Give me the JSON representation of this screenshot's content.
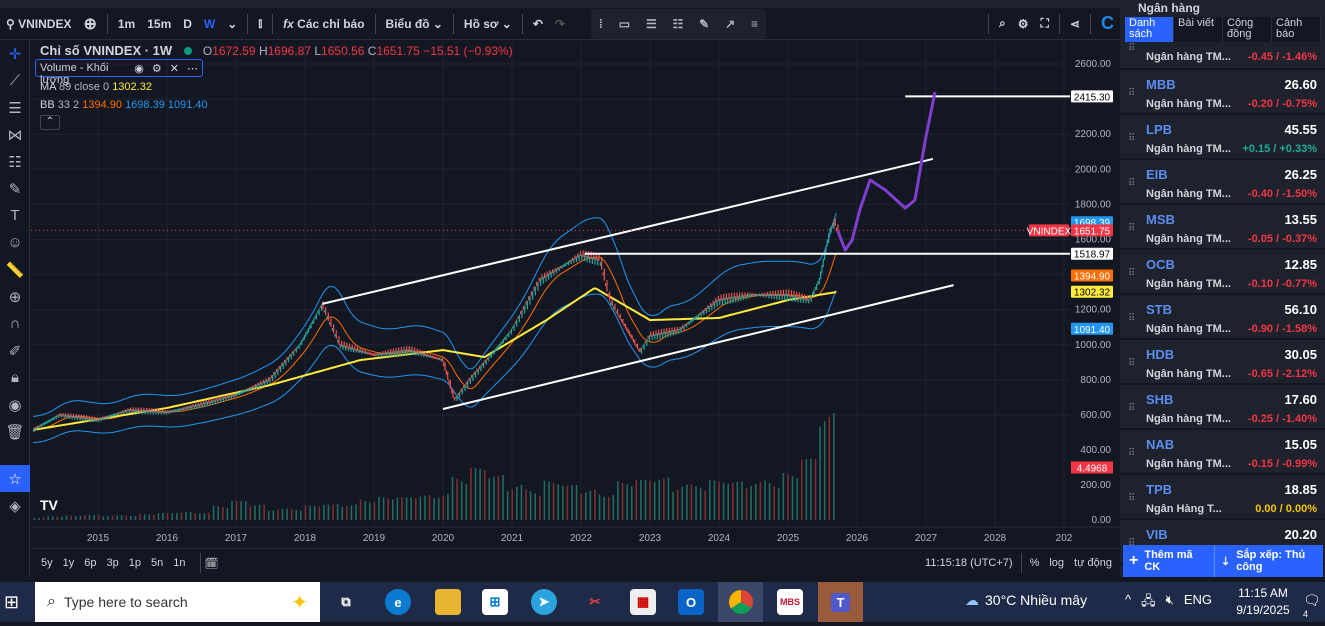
{
  "toolbar": {
    "symbol": "VNINDEX",
    "intervals": [
      "1m",
      "15m",
      "D",
      "W"
    ],
    "indicators": "Các chỉ báo",
    "chart": "Biểu đồ",
    "profile": "Hồ sơ"
  },
  "legend": {
    "title": "Chỉ số VNINDEX · 1W",
    "o_label": "O",
    "o": "1672.59",
    "h_label": "H",
    "h": "1696.87",
    "l_label": "L",
    "l": "1650.56",
    "c_label": "C",
    "c": "1651.75",
    "change": "−15.51 (−0.93%)",
    "volume": "Volume - Khối lượng",
    "ma_label": "MA",
    "ma_params": "89 close 0",
    "ma_value": "1302.32",
    "bb_label": "BB",
    "bb_params": "33 2",
    "bb_mid": "1394.90",
    "bb_upper": "1698.39",
    "bb_lower": "1091.40"
  },
  "price_axis": {
    "ticks": [
      "2600.00",
      "2400.00",
      "2200.00",
      "2000.00",
      "1800.00",
      "1600.00",
      "1400.00",
      "1200.00",
      "1000.00",
      "800.00",
      "600.00"
    ],
    "volume_ticks": [
      "400.00",
      "200.00",
      "0.00"
    ],
    "labels": {
      "line2415": "2415.30",
      "bb_upper": "1698.39",
      "last": "1651.75",
      "symbol_tag": "VNINDEX",
      "line1518": "1518.97",
      "bb_mid": "1394.90",
      "ma": "1302.32",
      "bb_lower": "1091.40",
      "volume": "4.4968"
    }
  },
  "time_axis": {
    "ticks": [
      "2015",
      "2016",
      "2017",
      "2018",
      "2019",
      "2020",
      "2021",
      "2022",
      "2023",
      "2024",
      "2025",
      "2026",
      "2027",
      "2028",
      "202"
    ]
  },
  "bottombar": {
    "ranges": [
      "5y",
      "1y",
      "6p",
      "3p",
      "1p",
      "5n",
      "1n"
    ],
    "clock": "11:15:18 (UTC+7)",
    "percent": "%",
    "log": "log",
    "auto": "tự động"
  },
  "colors": {
    "bg": "#131722",
    "up": "#26a69a",
    "down": "#ef5350",
    "ma": "#ffeb3b",
    "bb_mid": "#ff6d00",
    "bb_band": "#2196f3",
    "projection": "#7e3fd1",
    "channel": "#ffffff"
  },
  "chart_data": {
    "type": "line",
    "price": [
      [
        2014.06,
        515
      ],
      [
        2014.45,
        600
      ],
      [
        2015,
        572
      ],
      [
        2015.46,
        628
      ],
      [
        2016,
        615
      ],
      [
        2016.48,
        657
      ],
      [
        2017,
        714
      ],
      [
        2017.49,
        800
      ],
      [
        2017.93,
        999
      ],
      [
        2018.25,
        1227
      ],
      [
        2018.51,
        999
      ],
      [
        2019.01,
        942
      ],
      [
        2019.52,
        970
      ],
      [
        2020,
        913
      ],
      [
        2020.17,
        685
      ],
      [
        2020.39,
        800
      ],
      [
        2020.83,
        1000
      ],
      [
        2021,
        1084
      ],
      [
        2021.41,
        1369
      ],
      [
        2022,
        1511
      ],
      [
        2022.28,
        1483
      ],
      [
        2022.42,
        1255
      ],
      [
        2022.86,
        960
      ],
      [
        2023,
        1050
      ],
      [
        2023.43,
        1084
      ],
      [
        2024,
        1255
      ],
      [
        2024.46,
        1284
      ],
      [
        2025,
        1284
      ],
      [
        2025.32,
        1255
      ],
      [
        2025.46,
        1369
      ],
      [
        2025.61,
        1654
      ],
      [
        2025.68,
        1700
      ],
      [
        2025.72,
        1651
      ]
    ],
    "ma89": [
      [
        2014.06,
        515
      ],
      [
        2016,
        640
      ],
      [
        2017.5,
        771
      ],
      [
        2018.8,
        913
      ],
      [
        2020,
        970
      ],
      [
        2020.6,
        930
      ],
      [
        2021.5,
        1141
      ],
      [
        2022.2,
        1324
      ],
      [
        2023,
        1141
      ],
      [
        2024,
        1153
      ],
      [
        2025,
        1255
      ],
      [
        2025.72,
        1302
      ]
    ],
    "projection": [
      [
        2025.72,
        1651
      ],
      [
        2025.83,
        1540
      ],
      [
        2025.93,
        1597
      ],
      [
        2026.04,
        1768
      ],
      [
        2026.19,
        1939
      ],
      [
        2026.41,
        1882
      ],
      [
        2026.7,
        1779
      ],
      [
        2026.84,
        1825
      ],
      [
        2026.99,
        2167
      ],
      [
        2027.13,
        2440
      ]
    ],
    "channel_upper": [
      [
        2018.25,
        1233
      ],
      [
        2027.1,
        2059
      ]
    ],
    "channel_lower": [
      [
        2020,
        634
      ],
      [
        2027.4,
        1340
      ]
    ],
    "hlines": [
      {
        "value": 1518.97,
        "from": 2022.05
      },
      {
        "value": 2415.3,
        "from": 2026.7
      }
    ],
    "volume": [
      20,
      25,
      25,
      30,
      30,
      35,
      35,
      40,
      50,
      60,
      90,
      110,
      90,
      80,
      80,
      85,
      90,
      100,
      160,
      140,
      130,
      150,
      200,
      280,
      300,
      260,
      240,
      220,
      230,
      200,
      190,
      210,
      240,
      230,
      250,
      260,
      240,
      230,
      220,
      250,
      300,
      280,
      350,
      650
    ],
    "volume_range": [
      2014.0,
      2025.72
    ],
    "ylim": [
      0,
      2600
    ],
    "xlim": [
      2014,
      2029
    ]
  },
  "panel": {
    "header": "Ngân hàng",
    "tabs": [
      "Danh sách",
      "Bài viết",
      "Cộng đồng",
      "Cảnh báo"
    ],
    "first_row": {
      "name": "Ngân hàng TM...",
      "change": "-0.45 / -1.46%"
    },
    "rows": [
      {
        "sym": "MBB",
        "price": "26.60",
        "name": "Ngân hàng TM...",
        "change": "-0.20 / -0.75%",
        "dir": "down"
      },
      {
        "sym": "LPB",
        "price": "45.55",
        "name": "Ngân hàng TM...",
        "change": "+0.15 / +0.33%",
        "dir": "up"
      },
      {
        "sym": "EIB",
        "price": "26.25",
        "name": "Ngân hàng TM...",
        "change": "-0.40 / -1.50%",
        "dir": "down"
      },
      {
        "sym": "MSB",
        "price": "13.55",
        "name": "Ngân hàng TM...",
        "change": "-0.05 / -0.37%",
        "dir": "down"
      },
      {
        "sym": "OCB",
        "price": "12.85",
        "name": "Ngân hàng TM...",
        "change": "-0.10 / -0.77%",
        "dir": "down"
      },
      {
        "sym": "STB",
        "price": "56.10",
        "name": "Ngân hàng TM...",
        "change": "-0.90 / -1.58%",
        "dir": "down"
      },
      {
        "sym": "HDB",
        "price": "30.05",
        "name": "Ngân hàng TM...",
        "change": "-0.65 / -2.12%",
        "dir": "down"
      },
      {
        "sym": "SHB",
        "price": "17.60",
        "name": "Ngân hàng TM...",
        "change": "-0.25 / -1.40%",
        "dir": "down"
      },
      {
        "sym": "NAB",
        "price": "15.05",
        "name": "Ngân hàng TM...",
        "change": "-0.15 / -0.99%",
        "dir": "down"
      },
      {
        "sym": "TPB",
        "price": "18.85",
        "name": "Ngân Hàng T...",
        "change": "0.00 / 0.00%",
        "dir": "flat"
      },
      {
        "sym": "VIB",
        "price": "20.20",
        "name": "",
        "change": "",
        "dir": "down"
      }
    ],
    "add": "Thêm mã CK",
    "sort": "Sắp xếp: Thủ công"
  },
  "taskbar": {
    "search": "Type here to search",
    "weather": "30°C  Nhiều mây",
    "lang": "ENG",
    "time": "11:15 AM",
    "date": "9/19/2025",
    "mbs": "MBS",
    "notif": "4"
  }
}
